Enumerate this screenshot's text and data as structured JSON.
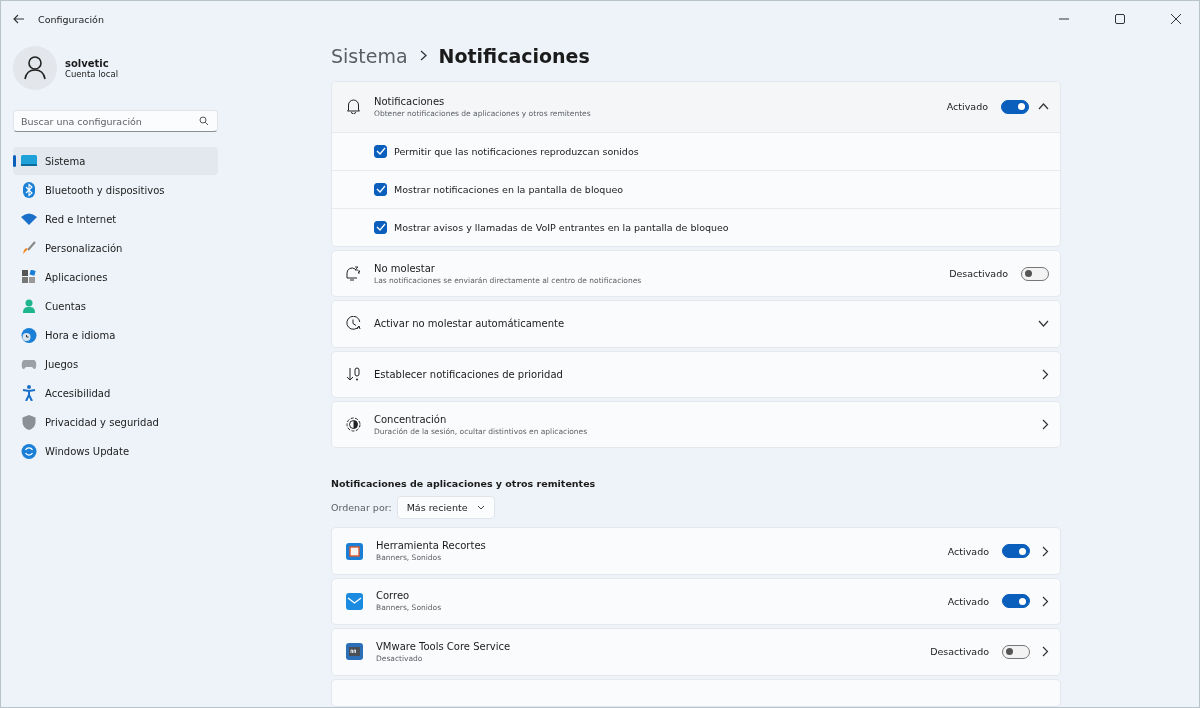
{
  "window": {
    "title": "Configuración"
  },
  "user": {
    "name": "solvetic",
    "account": "Cuenta local"
  },
  "search": {
    "placeholder": "Buscar una configuración"
  },
  "sidebar": {
    "items": [
      {
        "label": "Sistema",
        "selected": true
      },
      {
        "label": "Bluetooth y dispositivos",
        "selected": false
      },
      {
        "label": "Red e Internet",
        "selected": false
      },
      {
        "label": "Personalización",
        "selected": false
      },
      {
        "label": "Aplicaciones",
        "selected": false
      },
      {
        "label": "Cuentas",
        "selected": false
      },
      {
        "label": "Hora e idioma",
        "selected": false
      },
      {
        "label": "Juegos",
        "selected": false
      },
      {
        "label": "Accesibilidad",
        "selected": false
      },
      {
        "label": "Privacidad y seguridad",
        "selected": false
      },
      {
        "label": "Windows Update",
        "selected": false
      }
    ]
  },
  "breadcrumb": {
    "parent": "Sistema",
    "current": "Notificaciones"
  },
  "notifications": {
    "title": "Notificaciones",
    "subtitle": "Obtener notificaciones de aplicaciones y otros remitentes",
    "state_label": "Activado",
    "on": true,
    "expanded": true,
    "options": [
      {
        "label": "Permitir que las notificaciones reproduzcan sonidos",
        "checked": true
      },
      {
        "label": "Mostrar notificaciones en la pantalla de bloqueo",
        "checked": true
      },
      {
        "label": "Mostrar avisos y llamadas de VoIP entrantes en la pantalla de bloqueo",
        "checked": true
      }
    ]
  },
  "settings": [
    {
      "kind": "toggle",
      "title": "No molestar",
      "subtitle": "Las notificaciones se enviarán directamente al centro de notificaciones",
      "state_label": "Desactivado",
      "on": false
    },
    {
      "kind": "expand",
      "title": "Activar no molestar automáticamente"
    },
    {
      "kind": "link",
      "title": "Establecer notificaciones de prioridad"
    },
    {
      "kind": "link",
      "title": "Concentración",
      "subtitle": "Duración de la sesión, ocultar distintivos en aplicaciones"
    }
  ],
  "apps_section": {
    "title": "Notificaciones de aplicaciones y otros remitentes",
    "sort_label": "Ordenar por:",
    "sort_value": "Más reciente",
    "apps": [
      {
        "name": "Herramienta Recortes",
        "detail": "Banners, Sonidos",
        "state_label": "Activado",
        "on": true
      },
      {
        "name": "Correo",
        "detail": "Banners, Sonidos",
        "state_label": "Activado",
        "on": true
      },
      {
        "name": "VMware Tools Core Service",
        "detail": "Desactivado",
        "state_label": "Desactivado",
        "on": false
      }
    ]
  }
}
